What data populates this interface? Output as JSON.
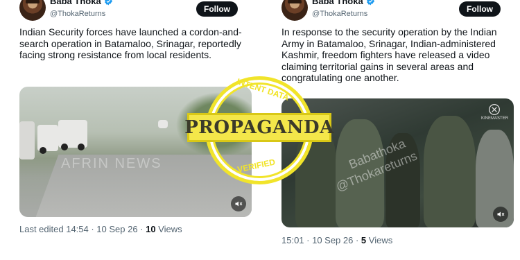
{
  "left_tweet": {
    "author": "Baba Thoka",
    "handle": "@ThokaReturns",
    "follow_label": "Follow",
    "text": "Indian Security forces have launched a cordon-and-search operation in Batamaloo, Srinagar, reportedly facing strong resistance from local residents.",
    "media_watermark": "AFRIN NEWS",
    "edited_prefix": "Last edited 14:54 · 10 Sep 26 · ",
    "views_count": "10",
    "views_label": " Views"
  },
  "right_tweet": {
    "author": "Baba Thoka",
    "handle": "@ThokaReturns",
    "follow_label": "Follow",
    "text": "In response to the security operation by the Indian Army in Batamaloo, Srinagar, Indian-administered Kashmir, freedom fighters have released a video claiming territorial gains in several areas and congratulating one another.",
    "media_watermark_1": "Babathoka",
    "media_watermark_2": "@Thokareturns",
    "kinemaster_label": "KINEMASTER",
    "time_prefix": "15:01 · 10 Sep 26 · ",
    "views_count": "5",
    "views_label": " Views"
  },
  "stamp": {
    "top_text": "INTENT DATA",
    "word": "PROPAGANDA",
    "bottom_text": "VERIFIED"
  },
  "colors": {
    "verified": "#1d9bf0",
    "stamp_yellow": "#f1e42a",
    "text_secondary": "#536471"
  },
  "icons": [
    "verified-badge-icon",
    "mute-icon"
  ]
}
